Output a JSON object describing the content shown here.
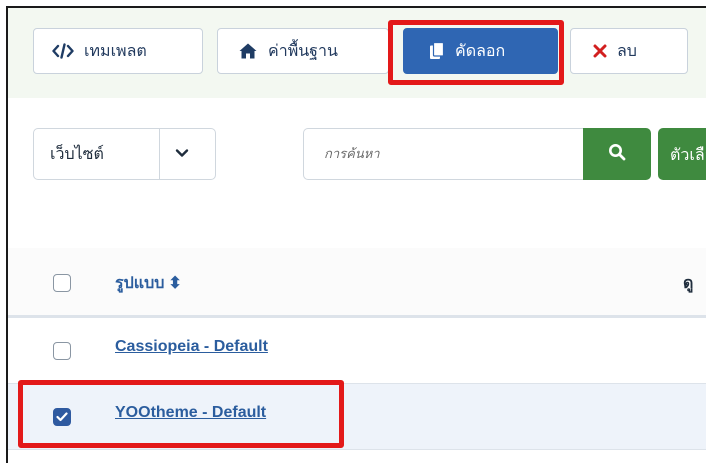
{
  "toolbar": {
    "template_label": "เทมเพลต",
    "default_label": "ค่าพื้นฐาน",
    "copy_label": "คัดลอก",
    "delete_label": "ลบ"
  },
  "filters": {
    "scope_value": "เว็บไซต์",
    "search_placeholder": "การค้นหา",
    "options_label": "ตัวเลือก"
  },
  "table": {
    "header_style": "รูปแบบ",
    "header_view": "ดู",
    "rows": [
      {
        "name": "Cassiopeia - Default",
        "checked": false
      },
      {
        "name": "YOOtheme - Default",
        "checked": true
      }
    ]
  },
  "colors": {
    "primary": "#2f66b3",
    "success": "#3f8a3f",
    "danger": "#d21f1f",
    "link": "#2b5d9e",
    "highlight": "#e31919"
  },
  "icons": [
    "code-icon",
    "home-icon",
    "copy-icon",
    "close-icon",
    "chevron-down-icon",
    "search-icon",
    "sort-icon",
    "check-icon"
  ]
}
